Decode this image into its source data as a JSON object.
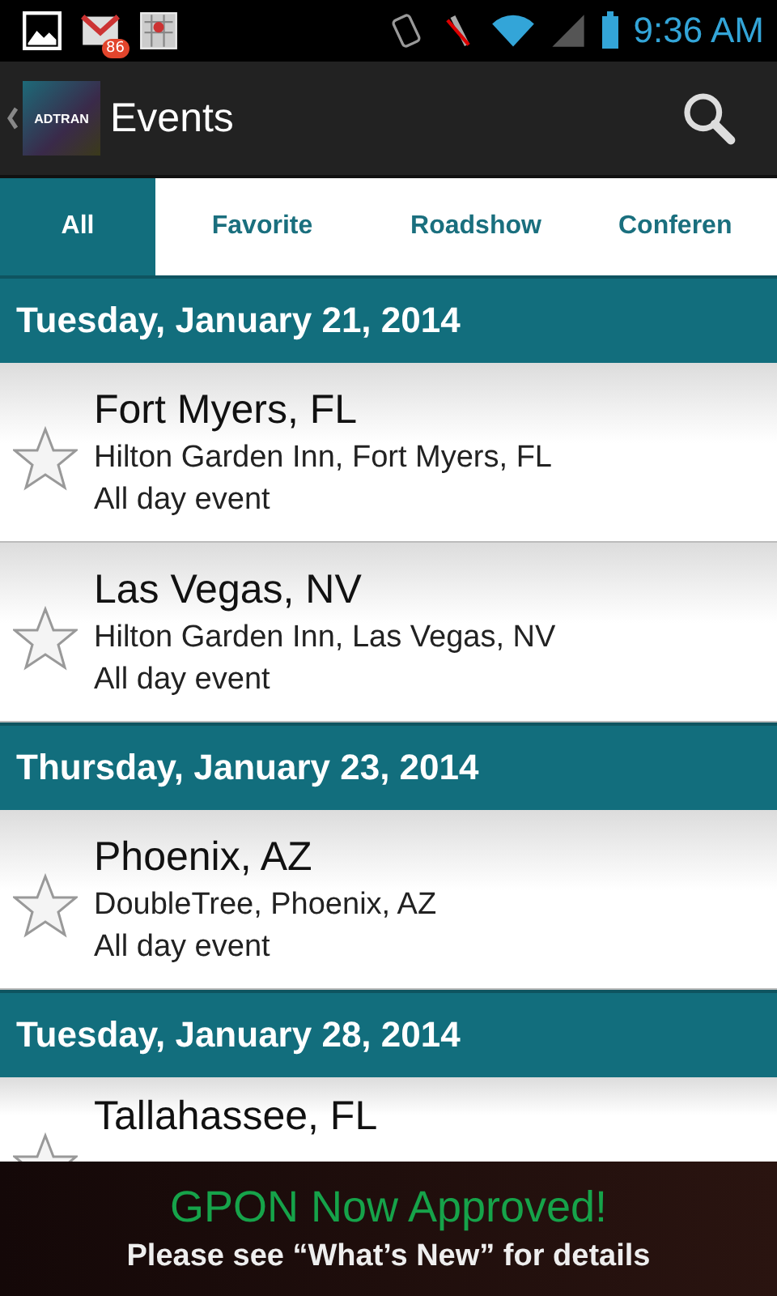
{
  "status_bar": {
    "notification_count": "86",
    "time": "9:36 AM"
  },
  "action_bar": {
    "logo": "ADTRAN",
    "title": "Events"
  },
  "tabs": [
    {
      "label": "All",
      "selected": true
    },
    {
      "label": "Favorite",
      "selected": false
    },
    {
      "label": "Roadshow",
      "selected": false
    },
    {
      "label": "Conferen",
      "selected": false
    }
  ],
  "sections": [
    {
      "date": "Tuesday, January 21, 2014",
      "events": [
        {
          "city": "Fort Myers, FL",
          "venue": "Hilton Garden Inn, Fort Myers, FL",
          "time": "All day event",
          "favorite": false
        },
        {
          "city": "Las Vegas, NV",
          "venue": "Hilton Garden Inn, Las Vegas, NV",
          "time": "All day event",
          "favorite": false
        }
      ]
    },
    {
      "date": "Thursday, January 23, 2014",
      "events": [
        {
          "city": "Phoenix, AZ",
          "venue": "DoubleTree, Phoenix, AZ",
          "time": "All day event",
          "favorite": false
        }
      ]
    },
    {
      "date": "Tuesday, January 28, 2014",
      "events": [
        {
          "city": "Tallahassee, FL",
          "favorite": false
        }
      ]
    }
  ],
  "banner": {
    "headline": "GPON Now Approved!",
    "subtext": "Please see “What’s New” for details"
  }
}
